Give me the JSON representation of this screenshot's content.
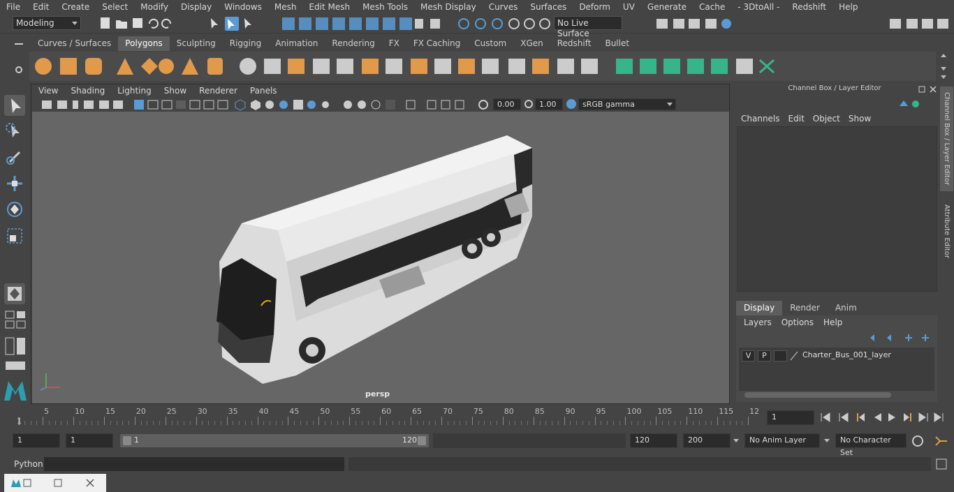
{
  "menubar": [
    "File",
    "Edit",
    "Create",
    "Select",
    "Modify",
    "Display",
    "Windows",
    "Mesh",
    "Edit Mesh",
    "Mesh Tools",
    "Mesh Display",
    "Curves",
    "Surfaces",
    "Deform",
    "UV",
    "Generate",
    "Cache",
    "- 3DtoAll -",
    "Redshift",
    "Help"
  ],
  "status": {
    "mode": "Modeling",
    "live_surface": "No Live Surface"
  },
  "shelf_tabs": [
    "Curves / Surfaces",
    "Polygons",
    "Sculpting",
    "Rigging",
    "Animation",
    "Rendering",
    "FX",
    "FX Caching",
    "Custom",
    "XGen",
    "Redshift",
    "Bullet"
  ],
  "shelf_active": "Polygons",
  "viewport": {
    "menu": [
      "View",
      "Shading",
      "Lighting",
      "Show",
      "Renderer",
      "Panels"
    ],
    "exposure": "0.00",
    "gamma": "1.00",
    "color_space": "sRGB gamma",
    "camera_label": "persp"
  },
  "channel_box": {
    "title": "Channel Box / Layer Editor",
    "menu": [
      "Channels",
      "Edit",
      "Object",
      "Show"
    ]
  },
  "layer_editor": {
    "tabs": [
      "Display",
      "Render",
      "Anim"
    ],
    "active_tab": "Display",
    "menu": [
      "Layers",
      "Options",
      "Help"
    ],
    "layers": [
      {
        "v": "V",
        "p": "P",
        "name": "Charter_Bus_001_layer"
      }
    ]
  },
  "side_tabs": [
    "Channel Box / Layer Editor",
    "Attribute Editor"
  ],
  "timeline": {
    "ticks": [
      "5",
      "10",
      "15",
      "20",
      "25",
      "30",
      "35",
      "40",
      "45",
      "50",
      "55",
      "60",
      "65",
      "70",
      "75",
      "80",
      "85",
      "90",
      "95",
      "100",
      "105",
      "110",
      "115",
      "12"
    ],
    "start_tick": "1",
    "current_frame": "1"
  },
  "range": {
    "start_field": "1",
    "start_field2": "1",
    "bar_start": "1",
    "bar_end": "120",
    "end_field": "120",
    "end_field2": "200",
    "anim_layer": "No Anim Layer",
    "character_set": "No Character Set"
  },
  "cmdline": {
    "label": "Python"
  },
  "colors": {
    "accent_blue": "#5b9bd5",
    "shelf_orange": "#e09a4a",
    "shelf_green": "#37b58a"
  }
}
